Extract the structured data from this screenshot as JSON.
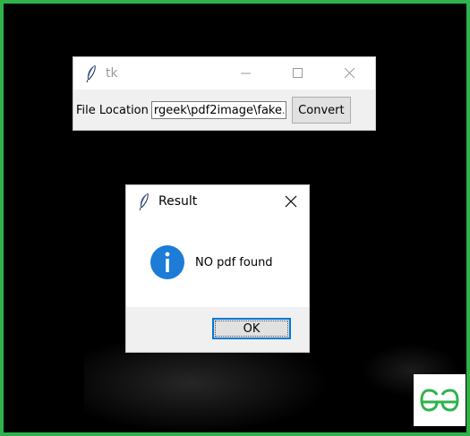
{
  "tk_window": {
    "title": "tk",
    "label": "File Location",
    "path_value": "rgeek\\pdf2image\\fake.",
    "convert_label": "Convert"
  },
  "dialog": {
    "title": "Result",
    "message": "NO pdf found",
    "ok_label": "OK",
    "icon": "info-icon"
  },
  "logo": {
    "text": "GG",
    "color": "#2fb24c"
  },
  "colors": {
    "frame_border": "#2fb24c",
    "info_blue": "#1c7cd6",
    "focus_blue": "#0078d7"
  }
}
